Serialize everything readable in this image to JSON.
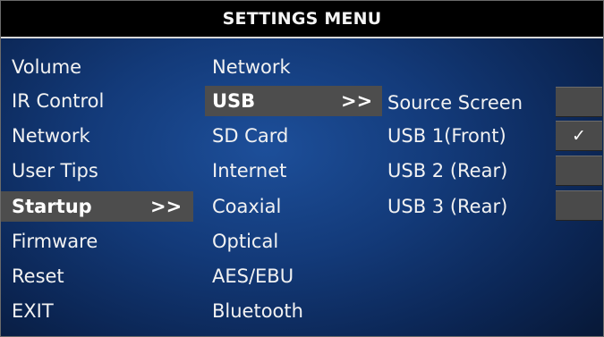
{
  "header": {
    "title": "SETTINGS MENU"
  },
  "menu_main": [
    {
      "label": "Volume"
    },
    {
      "label": "IR Control"
    },
    {
      "label": "Network"
    },
    {
      "label": "User Tips"
    },
    {
      "label": "Startup",
      "arrow": ">>",
      "selected": true
    },
    {
      "label": "Firmware"
    },
    {
      "label": "Reset"
    },
    {
      "label": "EXIT"
    }
  ],
  "menu_source": [
    {
      "label": "Network"
    },
    {
      "label": "USB",
      "arrow": ">>",
      "selected": true
    },
    {
      "label": "SD Card"
    },
    {
      "label": "Internet"
    },
    {
      "label": "Coaxial"
    },
    {
      "label": "Optical"
    },
    {
      "label": "AES/EBU"
    },
    {
      "label": "Bluetooth"
    }
  ],
  "menu_usb": [
    {
      "label": "Source Screen",
      "checked": false
    },
    {
      "label": "USB 1(Front)",
      "checked": true
    },
    {
      "label": "USB 2 (Rear)",
      "checked": false
    },
    {
      "label": "USB 3 (Rear)",
      "checked": false
    }
  ],
  "check_mark": "✓",
  "colors": {
    "title_bar": "#000000",
    "selection_highlight": "#4d4d4d",
    "background_center": "#1d4f9a",
    "background_edge": "#071632",
    "text": "#f2f2f2"
  }
}
